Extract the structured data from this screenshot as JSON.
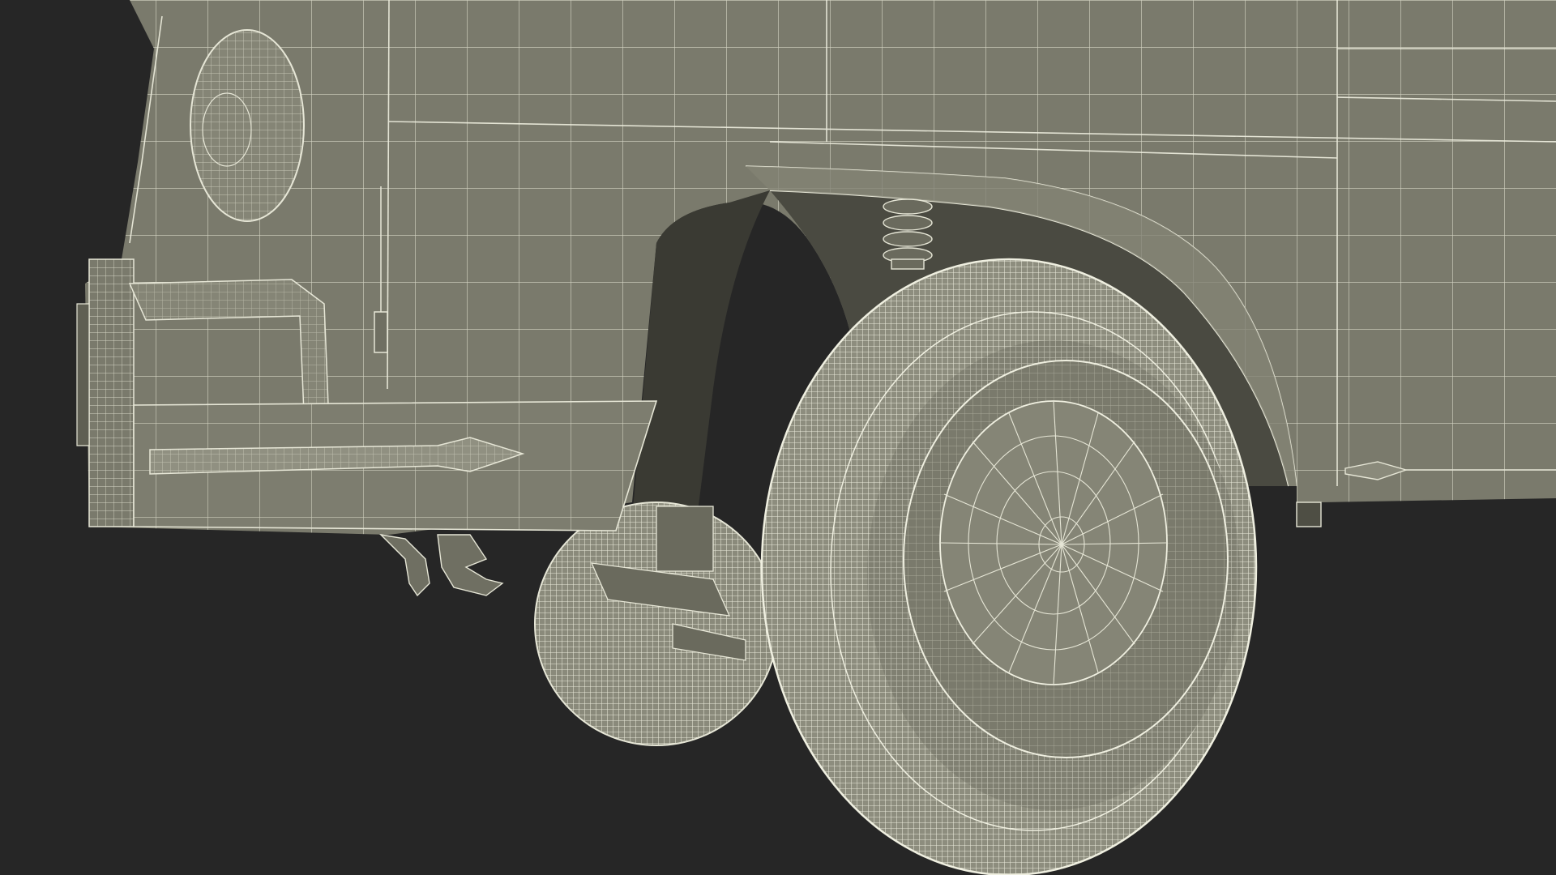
{
  "scene": {
    "background_color": "#262626",
    "body_color": "#7a7a6c",
    "body_shadow_color": "#5f5f53",
    "wire_color": "#e6e6d6",
    "rear_wheel_dark": "#4e4e44"
  }
}
